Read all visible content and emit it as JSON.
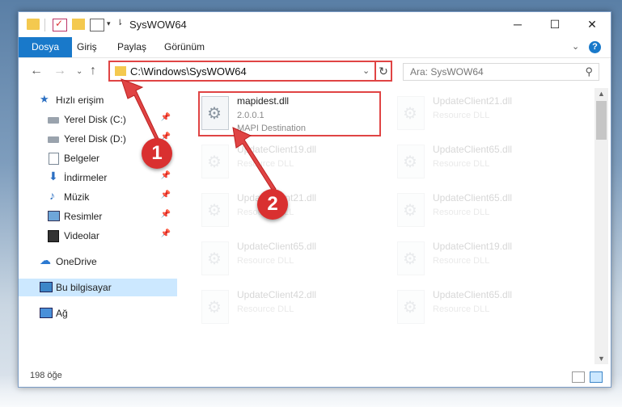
{
  "window": {
    "title": "SysWOW64",
    "minimize": "─",
    "maximize": "☐",
    "close": "✕"
  },
  "ribbon": {
    "tabs": [
      "Dosya",
      "Giriş",
      "Paylaş",
      "Görünüm"
    ],
    "expand": "⌄",
    "help": "?"
  },
  "nav": {
    "back": "←",
    "forward": "→",
    "recent": "⌄",
    "up": "↑",
    "address": "C:\\Windows\\SysWOW64",
    "address_dropdown": "⌄",
    "refresh": "↻",
    "search_placeholder": "Ara: SysWOW64",
    "search_icon": "⚲"
  },
  "sidebar": {
    "items": [
      {
        "label": "Hızlı erişim",
        "icon": "star-icon",
        "glyph": "★",
        "pin": ""
      },
      {
        "label": "Yerel Disk (C:)",
        "icon": "disk-icon",
        "glyph": "",
        "pin": "📌"
      },
      {
        "label": "Yerel Disk (D:)",
        "icon": "disk-icon",
        "glyph": "",
        "pin": "📌"
      },
      {
        "label": "Belgeler",
        "icon": "documents-icon",
        "glyph": "",
        "pin": "📌"
      },
      {
        "label": "İndirmeler",
        "icon": "download-icon",
        "glyph": "⬇",
        "pin": "📌"
      },
      {
        "label": "Müzik",
        "icon": "music-icon",
        "glyph": "♪",
        "pin": "📌"
      },
      {
        "label": "Resimler",
        "icon": "pictures-icon",
        "glyph": "",
        "pin": "📌"
      },
      {
        "label": "Videolar",
        "icon": "videos-icon",
        "glyph": "",
        "pin": "📌"
      },
      {
        "label": "OneDrive",
        "icon": "cloud-icon",
        "glyph": "☁",
        "pin": ""
      },
      {
        "label": "Bu bilgisayar",
        "icon": "computer-icon",
        "glyph": "",
        "pin": ""
      },
      {
        "label": "Ağ",
        "icon": "network-icon",
        "glyph": "",
        "pin": ""
      }
    ]
  },
  "files": {
    "highlighted": {
      "name": "mapidest.dll",
      "version": "2.0.0.1",
      "desc": "MAPI Destination"
    },
    "faded": [
      {
        "name": "UpdateClient21.dll",
        "desc": "Resource DLL"
      },
      {
        "name": "UpdateClient19.dll",
        "desc": "Resource DLL"
      },
      {
        "name": "UpdateClient65.dll",
        "desc": "Resource DLL"
      },
      {
        "name": "UpdateClient21.dll",
        "desc": "Resource DLL"
      },
      {
        "name": "UpdateClient65.dll",
        "desc": "Resource DLL"
      },
      {
        "name": "UpdateClient65.dll",
        "desc": "Resource DLL"
      },
      {
        "name": "UpdateClient19.dll",
        "desc": "Resource DLL"
      },
      {
        "name": "UpdateClient42.dll",
        "desc": "Resource DLL"
      },
      {
        "name": "UpdateClient65.dll",
        "desc": "Resource DLL"
      }
    ]
  },
  "status": {
    "count": "198 öğe"
  },
  "markers": {
    "one": "1",
    "two": "2"
  },
  "colors": {
    "accent": "#1979ca",
    "highlight": "#e04444",
    "marker": "#d93030"
  }
}
